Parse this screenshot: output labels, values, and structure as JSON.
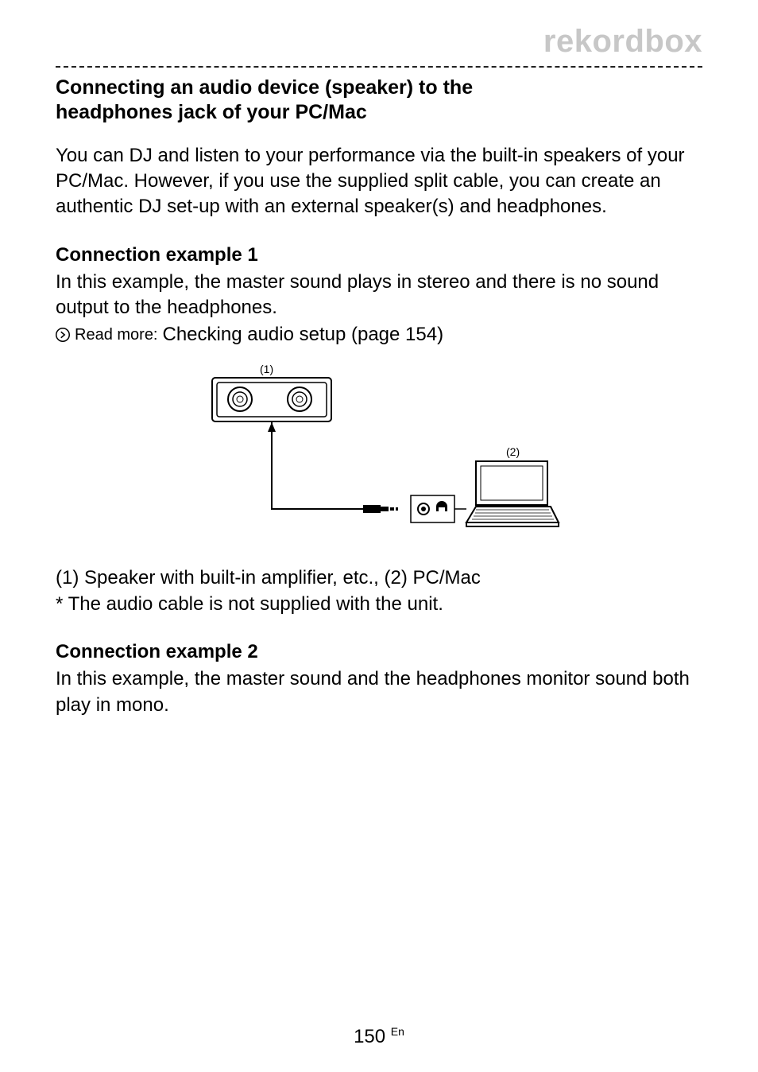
{
  "brand": "rekordbox",
  "section_title_line1": "Connecting an audio device (speaker) to the",
  "section_title_line2": "headphones jack of your PC/Mac",
  "intro_text": "You can DJ and listen to your performance via the built-in speakers of your PC/Mac. However, if you use the supplied split cable, you can create an authentic DJ set-up with an external speaker(s) and headphones.",
  "ex1": {
    "title": "Connection example 1",
    "body": "In this example, the master sound plays in stereo and there is no sound output to the headphones.",
    "readmore_prefix": "Read more:",
    "readmore_link": "Checking audio setup (page 154)",
    "diagram_labels": {
      "label1": "(1)",
      "label2": "(2)"
    },
    "caption": "(1) Speaker with built-in amplifier, etc., (2) PC/Mac",
    "footnote": "* The audio cable is not supplied with the unit."
  },
  "ex2": {
    "title": "Connection example 2",
    "body": "In this example, the master sound and the headphones monitor sound both play in mono."
  },
  "page_number": "150",
  "page_lang": "En"
}
